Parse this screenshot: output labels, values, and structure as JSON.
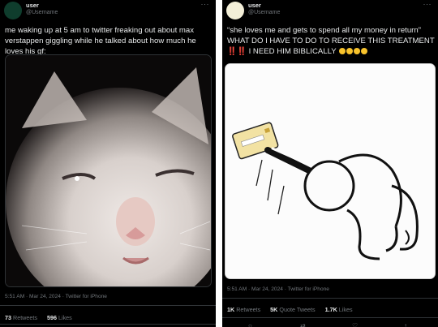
{
  "left_tweet": {
    "user_name": "user",
    "user_handle": "@Username",
    "text": "me waking up at 5 am to twitter freaking out about max verstappen giggling while he talked about how much he loves his gf:",
    "meta": "5:51 AM · Mar 24, 2024 · Twitter for iPhone",
    "retweets_count": "73",
    "retweets_label": "Retweets",
    "likes_count": "596",
    "likes_label": "Likes"
  },
  "right_tweet": {
    "user_name": "user",
    "user_handle": "@Username",
    "text_line1": "“she loves me and gets to spend all my money in return” WHAT DO I HAVE TO DO TO RECEIVE THIS TREATMENT",
    "alarm": "‼️‼️",
    "text_line2": "I NEED HIM BIBLICALLY",
    "meta": "5:51 AM · Mar 24, 2024 · Twitter for iPhone",
    "retweets_count": "1K",
    "retweets_label": "Retweets",
    "quotes_count": "5K",
    "quotes_label": "Quote Tweets",
    "likes_count": "1.7K",
    "likes_label": "Likes"
  },
  "colors": {
    "background": "#000000",
    "text": "#e7e9ea",
    "secondary": "#71767b",
    "alarm": "#f4212e"
  },
  "icons": [
    "more-icon",
    "reply-icon",
    "retweet-icon",
    "like-icon",
    "share-icon"
  ]
}
